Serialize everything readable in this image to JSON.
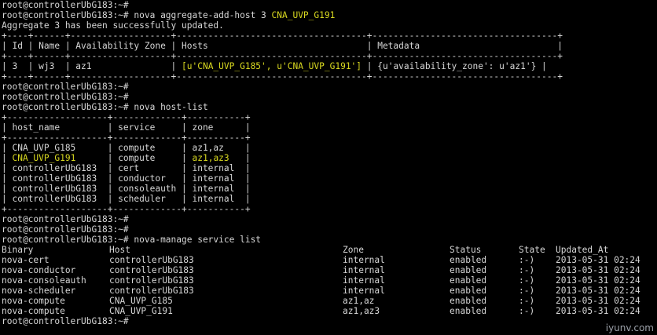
{
  "terminal": {
    "background": "#000000",
    "text_color": "#d6d6d6",
    "highlight_color": "#d8d820",
    "prompt": "root@controllerUbG183:~#",
    "cmd1_prefix": "root@controllerUbG183:~# nova aggregate-add-host 3 ",
    "cmd1_host": "CNA_UVP_G191",
    "cmd1_result": "Aggregate 3 has been successfully updated.",
    "agg_border": "+----+------+-------------------+------------------------------------+-----------------------------------+",
    "agg_header": "| Id | Name | Availability Zone | Hosts                              | Metadata                          |",
    "agg_row_prefix": "| 3  | wj3  | az1               | ",
    "agg_row_hosts": "[u'CNA_UVP_G185', u'CNA_UVP_G191']",
    "agg_row_suffix": " | {u'availability_zone': u'az1'} |",
    "cmd2": "root@controllerUbG183:~# nova host-list",
    "host_border": "+-------------------+-------------+-----------+",
    "host_header": "| host_name         | service     | zone      |",
    "host_rows": [
      "| CNA_UVP_G185      | compute     | az1,az    |",
      "| controllerUbG183  | cert        | internal  |",
      "| controllerUbG183  | conductor   | internal  |",
      "| controllerUbG183  | consoleauth | internal  |",
      "| controllerUbG183  | scheduler   | internal  |"
    ],
    "host_hl_pre": "| ",
    "host_hl_name": "CNA_UVP_G191",
    "host_hl_mid": "      | compute     | ",
    "host_hl_zone": "az1,az3",
    "host_hl_post": "   |",
    "cmd3": "root@controllerUbG183:~# nova-manage service list",
    "svc_header": {
      "binary": "Binary",
      "host": "Host",
      "zone": "Zone",
      "status": "Status",
      "state": "State",
      "updated": "Updated_At"
    },
    "svc_rows": [
      {
        "binary": "nova-cert",
        "host": "controllerUbG183",
        "zone": "internal",
        "status": "enabled",
        "state": ":-)",
        "updated": "2013-05-31 02:24"
      },
      {
        "binary": "nova-conductor",
        "host": "controllerUbG183",
        "zone": "internal",
        "status": "enabled",
        "state": ":-)",
        "updated": "2013-05-31 02:24"
      },
      {
        "binary": "nova-consoleauth",
        "host": "controllerUbG183",
        "zone": "internal",
        "status": "enabled",
        "state": ":-)",
        "updated": "2013-05-31 02:24"
      },
      {
        "binary": "nova-scheduler",
        "host": "controllerUbG183",
        "zone": "internal",
        "status": "enabled",
        "state": ":-)",
        "updated": "2013-05-31 02:24"
      },
      {
        "binary": "nova-compute",
        "host": "CNA_UVP_G185",
        "zone": "az1,az",
        "status": "enabled",
        "state": ":-)",
        "updated": "2013-05-31 02:24"
      },
      {
        "binary": "nova-compute",
        "host": "CNA_UVP_G191",
        "zone": "az1,az3",
        "status": "enabled",
        "state": ":-)",
        "updated": "2013-05-31 02:24",
        "highlight": true
      }
    ],
    "watermark": "iyunv.com"
  }
}
